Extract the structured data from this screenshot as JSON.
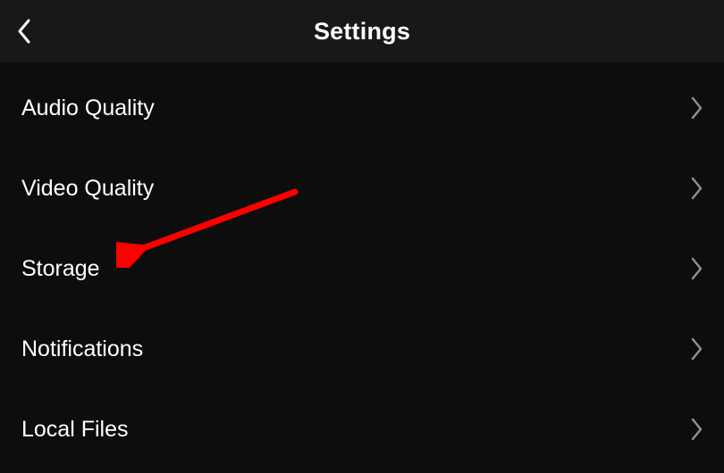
{
  "header": {
    "title": "Settings"
  },
  "menu": {
    "items": [
      {
        "label": "Audio Quality",
        "name": "audio-quality"
      },
      {
        "label": "Video Quality",
        "name": "video-quality"
      },
      {
        "label": "Storage",
        "name": "storage"
      },
      {
        "label": "Notifications",
        "name": "notifications"
      },
      {
        "label": "Local Files",
        "name": "local-files"
      }
    ]
  },
  "annotation": {
    "type": "arrow",
    "color": "#ff0000",
    "target": "storage"
  }
}
